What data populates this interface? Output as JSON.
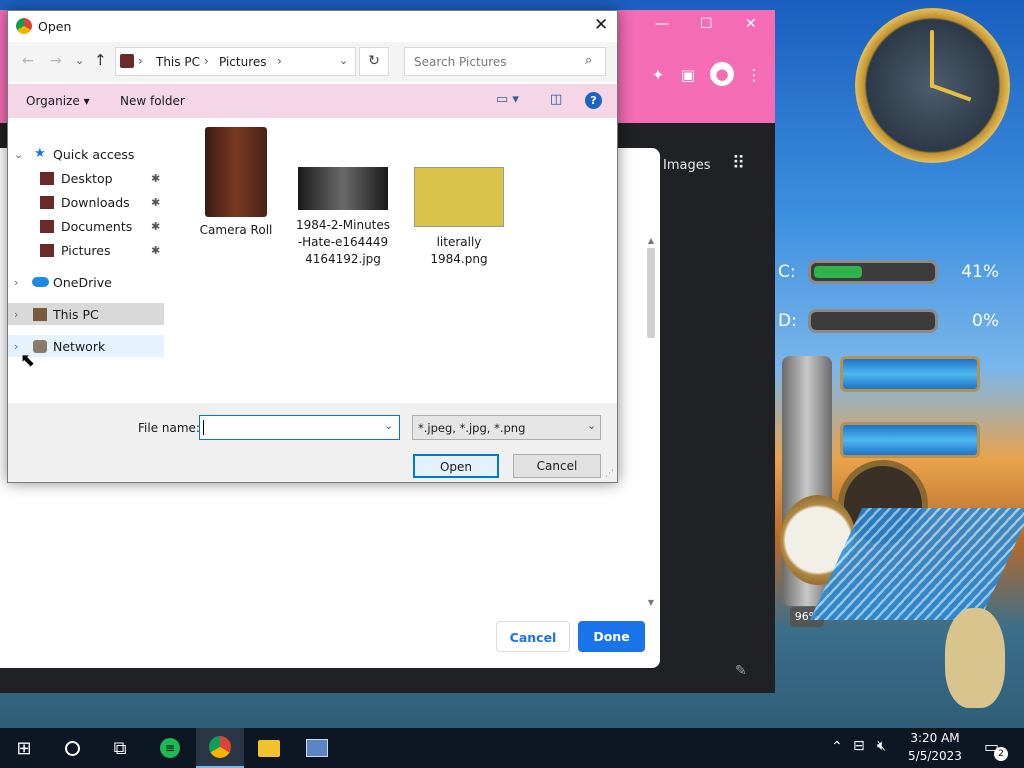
{
  "chrome": {
    "colors": {
      "toolbar": "#f36cb4",
      "page": "#202124"
    },
    "window_controls": [
      "—",
      "☐",
      "✕"
    ],
    "images_link": "Images",
    "upload_dialog": {
      "cancel_label": "Cancel",
      "done_label": "Done",
      "accent": "#1a73e8"
    }
  },
  "desktop_widgets": {
    "drive_c": {
      "label": "C:",
      "percent_text": "41%",
      "fill": 0.41
    },
    "drive_d": {
      "label": "D:",
      "percent_text": "0%",
      "fill": 0.0
    },
    "gauge_percent": "96%"
  },
  "open_dialog": {
    "title": "Open",
    "breadcrumb": [
      "This PC",
      "Pictures"
    ],
    "search_placeholder": "Search Pictures",
    "organize_label": "Organize",
    "new_folder_label": "New folder",
    "nav": {
      "quick_access": "Quick access",
      "pinned": [
        {
          "label": "Desktop"
        },
        {
          "label": "Downloads"
        },
        {
          "label": "Documents"
        },
        {
          "label": "Pictures"
        }
      ],
      "onedrive": "OneDrive",
      "this_pc": "This PC",
      "network": "Network"
    },
    "files": [
      {
        "name": "Camera Roll",
        "type": "folder"
      },
      {
        "name": "1984-2-Minutes-Hate-e1644494164192.jpg",
        "type": "image"
      },
      {
        "name": "literally 1984.png",
        "type": "image"
      }
    ],
    "file_name_label": "File name:",
    "file_name_value": "",
    "file_type_value": "*.jpeg, *.jpg, *.png",
    "open_label": "Open",
    "cancel_label": "Cancel"
  },
  "taskbar": {
    "time": "3:20 AM",
    "date": "5/5/2023",
    "notification_count": "2"
  }
}
